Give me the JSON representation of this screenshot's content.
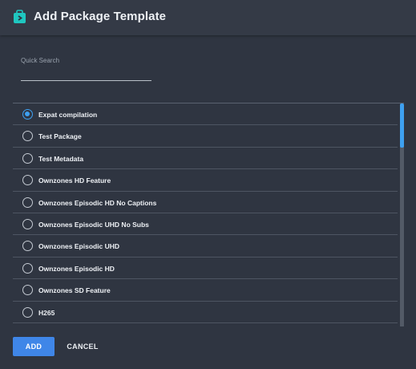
{
  "dialog": {
    "title": "Add Package Template",
    "icon": "package-icon",
    "accent_color": "#3ea0f0"
  },
  "search": {
    "label": "Quick Search",
    "value": "",
    "placeholder": ""
  },
  "templates": [
    {
      "label": "Expat compilation",
      "selected": true
    },
    {
      "label": "Test Package",
      "selected": false
    },
    {
      "label": "Test Metadata",
      "selected": false
    },
    {
      "label": "Ownzones HD Feature",
      "selected": false
    },
    {
      "label": "Ownzones Episodic HD No Captions",
      "selected": false
    },
    {
      "label": "Ownzones Episodic UHD No Subs",
      "selected": false
    },
    {
      "label": "Ownzones Episodic UHD",
      "selected": false
    },
    {
      "label": "Ownzones Episodic HD",
      "selected": false
    },
    {
      "label": "Ownzones SD Feature",
      "selected": false
    },
    {
      "label": "H265",
      "selected": false
    }
  ],
  "actions": {
    "add_label": "ADD",
    "cancel_label": "CANCEL",
    "add_color": "#3f86e8"
  }
}
